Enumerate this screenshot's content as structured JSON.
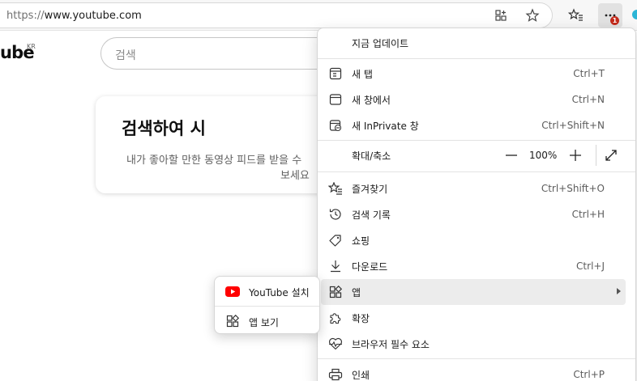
{
  "browser": {
    "url_protocol": "https://",
    "url_host": "www.youtube.com",
    "notification_count": "1"
  },
  "youtube": {
    "logo_text": "ube",
    "region": "KR",
    "search_placeholder": "검색",
    "card_title": "검색하여 시",
    "card_text_line1": "내가 좋아할 만한 동영상 피드를 받을 수",
    "card_text_line2": "보세요"
  },
  "menu": {
    "update": "지금 업데이트",
    "new_tab": {
      "label": "새 탭",
      "shortcut": "Ctrl+T"
    },
    "new_window": {
      "label": "새 창에서",
      "shortcut": "Ctrl+N"
    },
    "new_private": {
      "label": "새 InPrivate 창",
      "shortcut": "Ctrl+Shift+N"
    },
    "zoom": {
      "label": "확대/축소",
      "value": "100%"
    },
    "favorites": {
      "label": "즐겨찾기",
      "shortcut": "Ctrl+Shift+O"
    },
    "history": {
      "label": "검색 기록",
      "shortcut": "Ctrl+H"
    },
    "shopping": {
      "label": "쇼핑"
    },
    "downloads": {
      "label": "다운로드",
      "shortcut": "Ctrl+J"
    },
    "apps": {
      "label": "앱"
    },
    "extensions": {
      "label": "확장"
    },
    "essentials": {
      "label": "브라우저 필수 요소"
    },
    "print": {
      "label": "인쇄",
      "shortcut": "Ctrl+P"
    }
  },
  "submenu": {
    "install": "YouTube 설치",
    "view_apps": "앱 보기"
  },
  "colors": {
    "youtube_red": "#ff0000",
    "badge_red": "#c42b1c",
    "menu_highlight": "#ececec"
  }
}
